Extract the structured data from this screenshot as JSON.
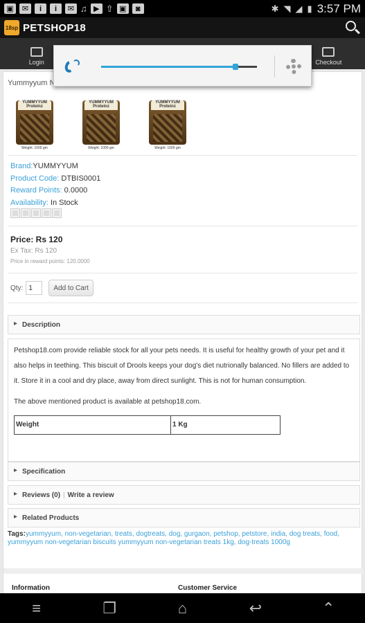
{
  "statusbar": {
    "time": "3:57 PM",
    "icons": [
      "image-icon",
      "mail-icon",
      "info-icon",
      "info-icon",
      "mail-icon",
      "music-icon",
      "play-icon",
      "upload-icon",
      "image-icon",
      "camera-icon"
    ]
  },
  "app": {
    "title": "PETSHOP18",
    "logo_text": "18sp"
  },
  "nav": {
    "items": [
      {
        "label": "Login"
      },
      {
        "label": ""
      },
      {
        "label": ""
      },
      {
        "label": ""
      },
      {
        "label": "Checkout"
      }
    ]
  },
  "volume": {
    "level": 0.86
  },
  "product": {
    "crumb": "Yummyyum N",
    "pack_label": "YUMMYYUM Proteinz",
    "thumbs": [
      {
        "weight": "Weight: 1000 gm"
      },
      {
        "weight": "Weight: 1000 gm"
      },
      {
        "weight": "Weight: 1000 gm"
      }
    ],
    "brand_label": "Brand:",
    "brand_value": "YUMMYYUM",
    "code_label": "Product Code:",
    "code_value": "DTBIS0001",
    "reward_label": "Reward Points:",
    "reward_value": "0.0000",
    "avail_label": "Availability:",
    "avail_value": "In Stock",
    "price": "Price: Rs 120",
    "ex_tax": "Ex Tax: Rs 120",
    "reward_price": "Price in reward points: 120.0000",
    "qty_label": "Qty:",
    "qty_value": "1",
    "add_to_cart": "Add to Cart"
  },
  "sections": {
    "description": "Description",
    "desc_text": "Petshop18.com provide reliable stock for all your pets needs. It is useful for healthy growth of your pet and it also helps in teething. This biscuit of Drools keeps your dog's diet nutrionally balanced. No fillers are added to it. Store it in a cool and dry place, away from direct sunlight. This is not for human consumption.",
    "desc_note": "The above mentioned product is available at petshop18.com.",
    "table": {
      "key": "Weight",
      "value": "1 Kg"
    },
    "specification": "Specification",
    "reviews": "Reviews (0)",
    "write_review": "Write a review",
    "related": "Related Products"
  },
  "tags": {
    "label": "Tags:",
    "list": "yummyyum, non-vegetarian, treats, dogtreats, dog, gurgaon, petshop, petstore, india, dog treats, food, yummyyum non-vegetarian biscuits yummyyum non-vegetarian treats 1kg, dog-treats 1000g"
  },
  "footer": {
    "information": "Information",
    "customer_service": "Customer Service"
  }
}
